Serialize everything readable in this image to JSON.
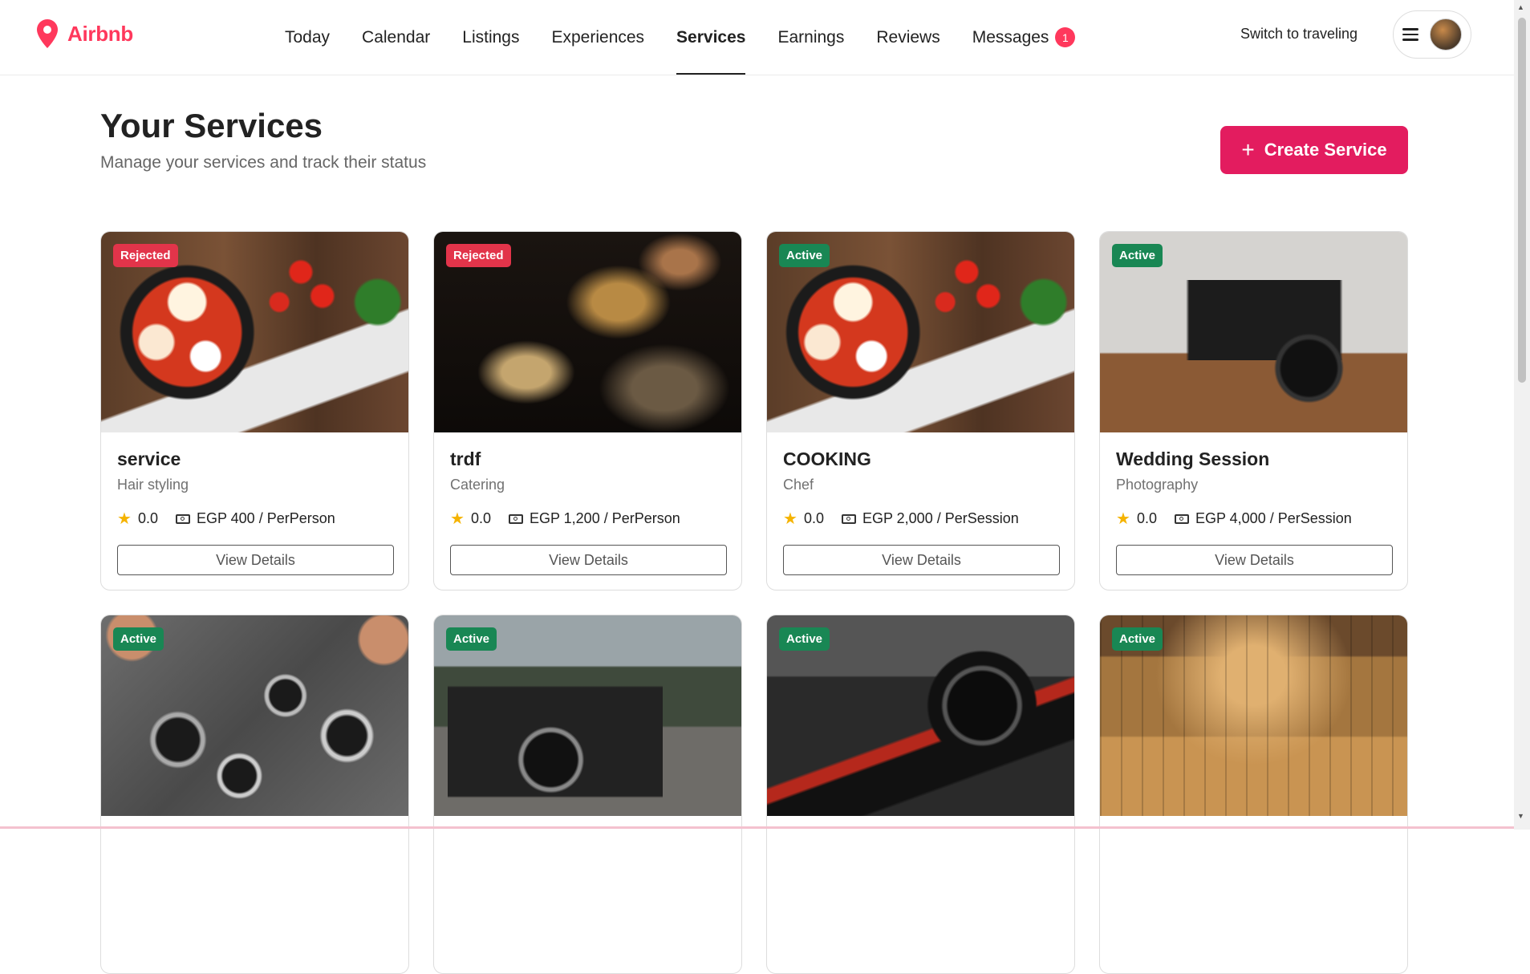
{
  "brand": {
    "name": "Airbnb",
    "color": "#ff385c"
  },
  "nav": {
    "items": [
      {
        "label": "Today"
      },
      {
        "label": "Calendar"
      },
      {
        "label": "Listings"
      },
      {
        "label": "Experiences"
      },
      {
        "label": "Services",
        "active": true
      },
      {
        "label": "Earnings"
      },
      {
        "label": "Reviews"
      },
      {
        "label": "Messages",
        "badge": "1"
      }
    ],
    "switch_label": "Switch to traveling"
  },
  "page": {
    "title": "Your Services",
    "subtitle": "Manage your services and track their status",
    "create_label": "Create Service"
  },
  "status_colors": {
    "Rejected": "#e2344a",
    "Active": "#198754"
  },
  "services": [
    {
      "status": "Rejected",
      "name": "service",
      "category": "Hair styling",
      "rating": "0.0",
      "price": "EGP 400 / PerPerson",
      "action": "View Details",
      "image": "shakshuka-pan"
    },
    {
      "status": "Rejected",
      "name": "trdf",
      "category": "Catering",
      "rating": "0.0",
      "price": "EGP 1,200 / PerPerson",
      "action": "View Details",
      "image": "catering-plates"
    },
    {
      "status": "Active",
      "name": "COOKING",
      "category": "Chef",
      "rating": "0.0",
      "price": "EGP 2,000 / PerSession",
      "action": "View Details",
      "image": "shakshuka-pan"
    },
    {
      "status": "Active",
      "name": "Wedding Session",
      "category": "Photography",
      "rating": "0.0",
      "price": "EGP 4,000 / PerSession",
      "action": "View Details",
      "image": "camera-on-table"
    },
    {
      "status": "Active",
      "image": "cameras-in-hands"
    },
    {
      "status": "Active",
      "image": "canon-on-road"
    },
    {
      "status": "Active",
      "image": "canon-dslr"
    },
    {
      "status": "Active",
      "image": "sauna-room"
    }
  ]
}
